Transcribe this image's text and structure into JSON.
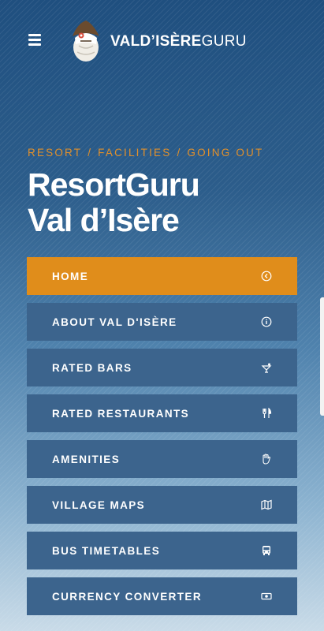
{
  "header": {
    "brand_bold": "VALD’ISÈRE",
    "brand_light": "GURU"
  },
  "breadcrumb": [
    "RESORT",
    "FACILITIES",
    "GOING OUT"
  ],
  "title": {
    "line1": "ResortGuru",
    "line2": "Val d’Isère"
  },
  "nav": [
    {
      "label": "HOME",
      "icon": "back-circle-icon"
    },
    {
      "label": "ABOUT VAL D'ISÈRE",
      "icon": "info-circle-icon"
    },
    {
      "label": "RATED BARS",
      "icon": "cocktail-icon"
    },
    {
      "label": "RATED RESTAURANTS",
      "icon": "cutlery-icon"
    },
    {
      "label": "AMENITIES",
      "icon": "hand-icon"
    },
    {
      "label": "VILLAGE MAPS",
      "icon": "map-icon"
    },
    {
      "label": "BUS TIMETABLES",
      "icon": "bus-icon"
    },
    {
      "label": "CURRENCY CONVERTER",
      "icon": "money-icon"
    }
  ],
  "colors": {
    "accent": "#e08d1b",
    "nav_bg": "#3c648d",
    "header_bg": "#1f4f7f"
  }
}
